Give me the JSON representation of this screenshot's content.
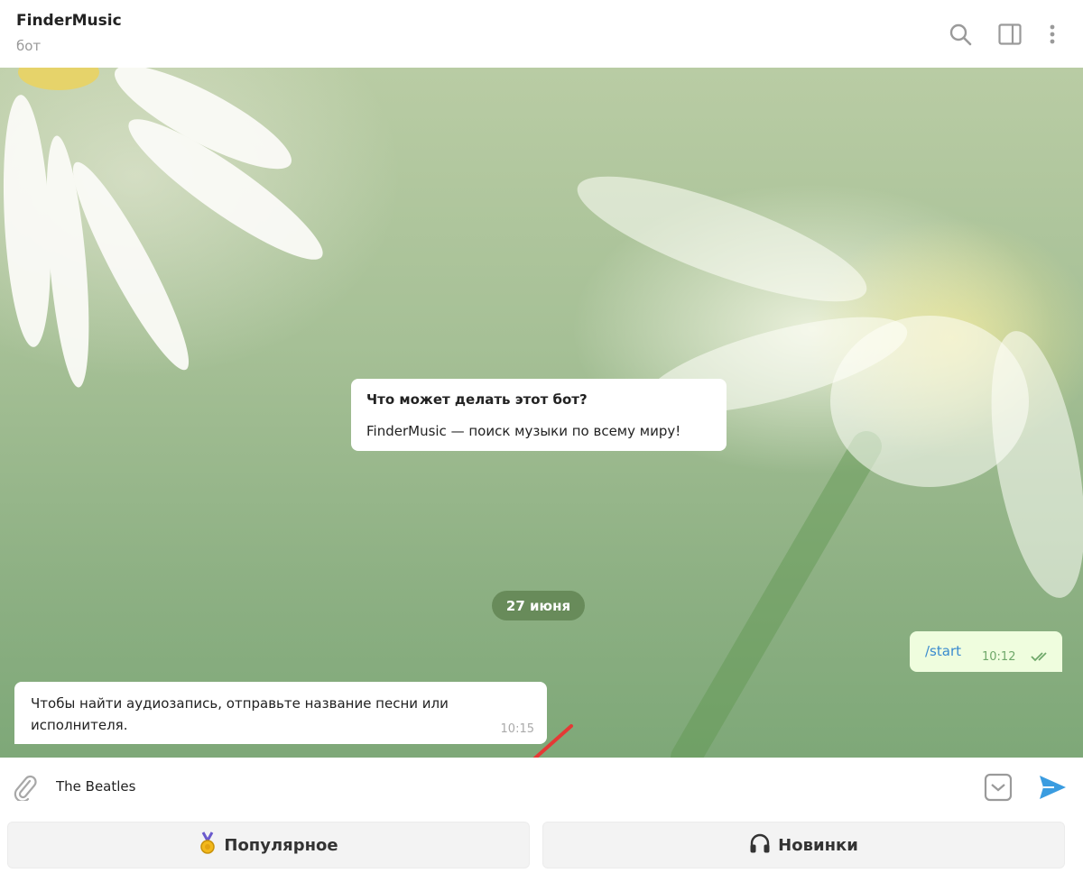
{
  "header": {
    "title": "FinderMusic",
    "subtitle": "бот",
    "icons": [
      "search-icon",
      "sidebar-toggle-icon",
      "more-vert-icon"
    ]
  },
  "intro_card": {
    "title": "Что может делать этот бот?",
    "text": "FinderMusic — поиск музыки по всему миру!"
  },
  "date_separator": "27 июня",
  "messages": [
    {
      "direction": "out",
      "text": "/start",
      "time": "10:12",
      "status": "read"
    },
    {
      "direction": "in",
      "text": "Чтобы найти аудиозапись, отправьте название песни или исполнителя.",
      "time": "10:15"
    }
  ],
  "composer": {
    "value": "The Beatles",
    "icons": [
      "attach-icon",
      "keyboard-toggle-icon",
      "send-icon"
    ]
  },
  "keyboard": {
    "buttons": [
      {
        "label": "Популярное",
        "icon": "medal-icon"
      },
      {
        "label": "Новинки",
        "icon": "headphones-icon"
      }
    ]
  },
  "colors": {
    "accent": "#3a8bcf",
    "outgoing_bubble": "#effdde",
    "date_pill": "#6c8f5e",
    "arrow": "#e53935"
  }
}
